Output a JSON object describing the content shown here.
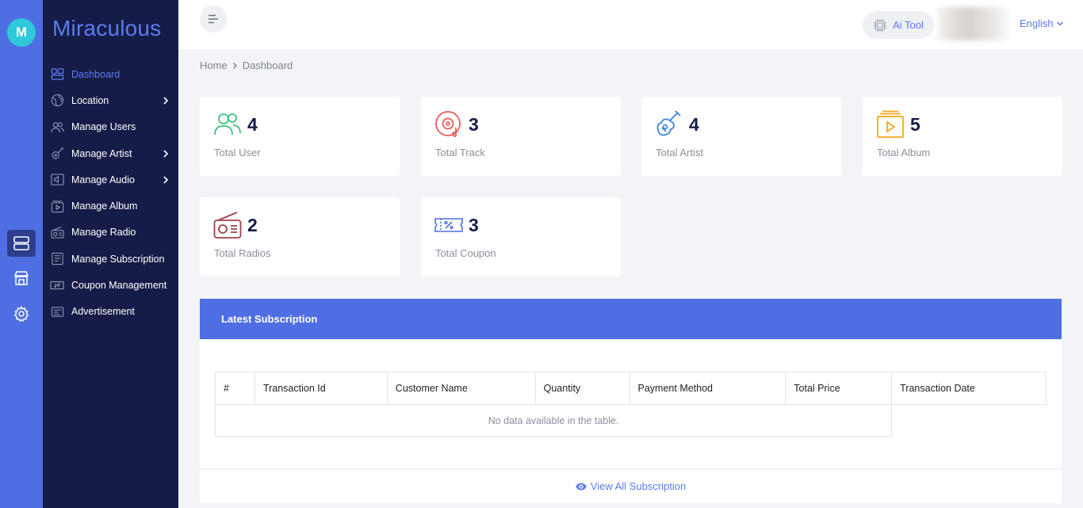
{
  "rail": {
    "logo_letter": "M"
  },
  "sidebar": {
    "brand": "Miraculous",
    "items": [
      {
        "label": "Dashboard",
        "icon": "dashboard-icon",
        "active": true,
        "has_children": false
      },
      {
        "label": "Location",
        "icon": "globe-icon",
        "active": false,
        "has_children": true
      },
      {
        "label": "Manage Users",
        "icon": "users-icon",
        "active": false,
        "has_children": false
      },
      {
        "label": "Manage Artist",
        "icon": "guitar-icon",
        "active": false,
        "has_children": true
      },
      {
        "label": "Manage Audio",
        "icon": "speaker-icon",
        "active": false,
        "has_children": true
      },
      {
        "label": "Manage Album",
        "icon": "album-icon",
        "active": false,
        "has_children": false
      },
      {
        "label": "Manage Radio",
        "icon": "radio-icon",
        "active": false,
        "has_children": false
      },
      {
        "label": "Manage Subscription",
        "icon": "subscription-icon",
        "active": false,
        "has_children": false
      },
      {
        "label": "Coupon Management",
        "icon": "coupon-icon",
        "active": false,
        "has_children": false
      },
      {
        "label": "Advertisement",
        "icon": "advertisement-icon",
        "active": false,
        "has_children": false
      }
    ]
  },
  "header": {
    "ai_tool_label": "Ai Tool",
    "language": "English"
  },
  "breadcrumb": {
    "home": "Home",
    "current": "Dashboard"
  },
  "stats": [
    {
      "value": "4",
      "label": "Total User",
      "icon": "users-icon",
      "color": "#3ec47c"
    },
    {
      "value": "3",
      "label": "Total Track",
      "icon": "vinyl-icon",
      "color": "#ef5a5a"
    },
    {
      "value": "4",
      "label": "Total Artist",
      "icon": "guitar-icon",
      "color": "#3a86e6"
    },
    {
      "value": "5",
      "label": "Total Album",
      "icon": "album-icon",
      "color": "#f2a71d"
    },
    {
      "value": "2",
      "label": "Total Radios",
      "icon": "radio-icon",
      "color": "#a1414a"
    },
    {
      "value": "3",
      "label": "Total Coupon",
      "icon": "coupon-icon",
      "color": "#4f6ee3"
    }
  ],
  "subscription": {
    "title": "Latest Subscription",
    "columns": [
      "#",
      "Transaction Id",
      "Customer Name",
      "Quantity",
      "Payment Method",
      "Total Price",
      "Transaction Date"
    ],
    "empty_text": "No data available in the table.",
    "view_all_label": "View All Subscription"
  },
  "colors": {
    "accent": "#4f6ee3",
    "sidebar_bg": "#161c48",
    "rail_bg": "#4f6ee3",
    "logo_bg": "#2ec9d9"
  }
}
